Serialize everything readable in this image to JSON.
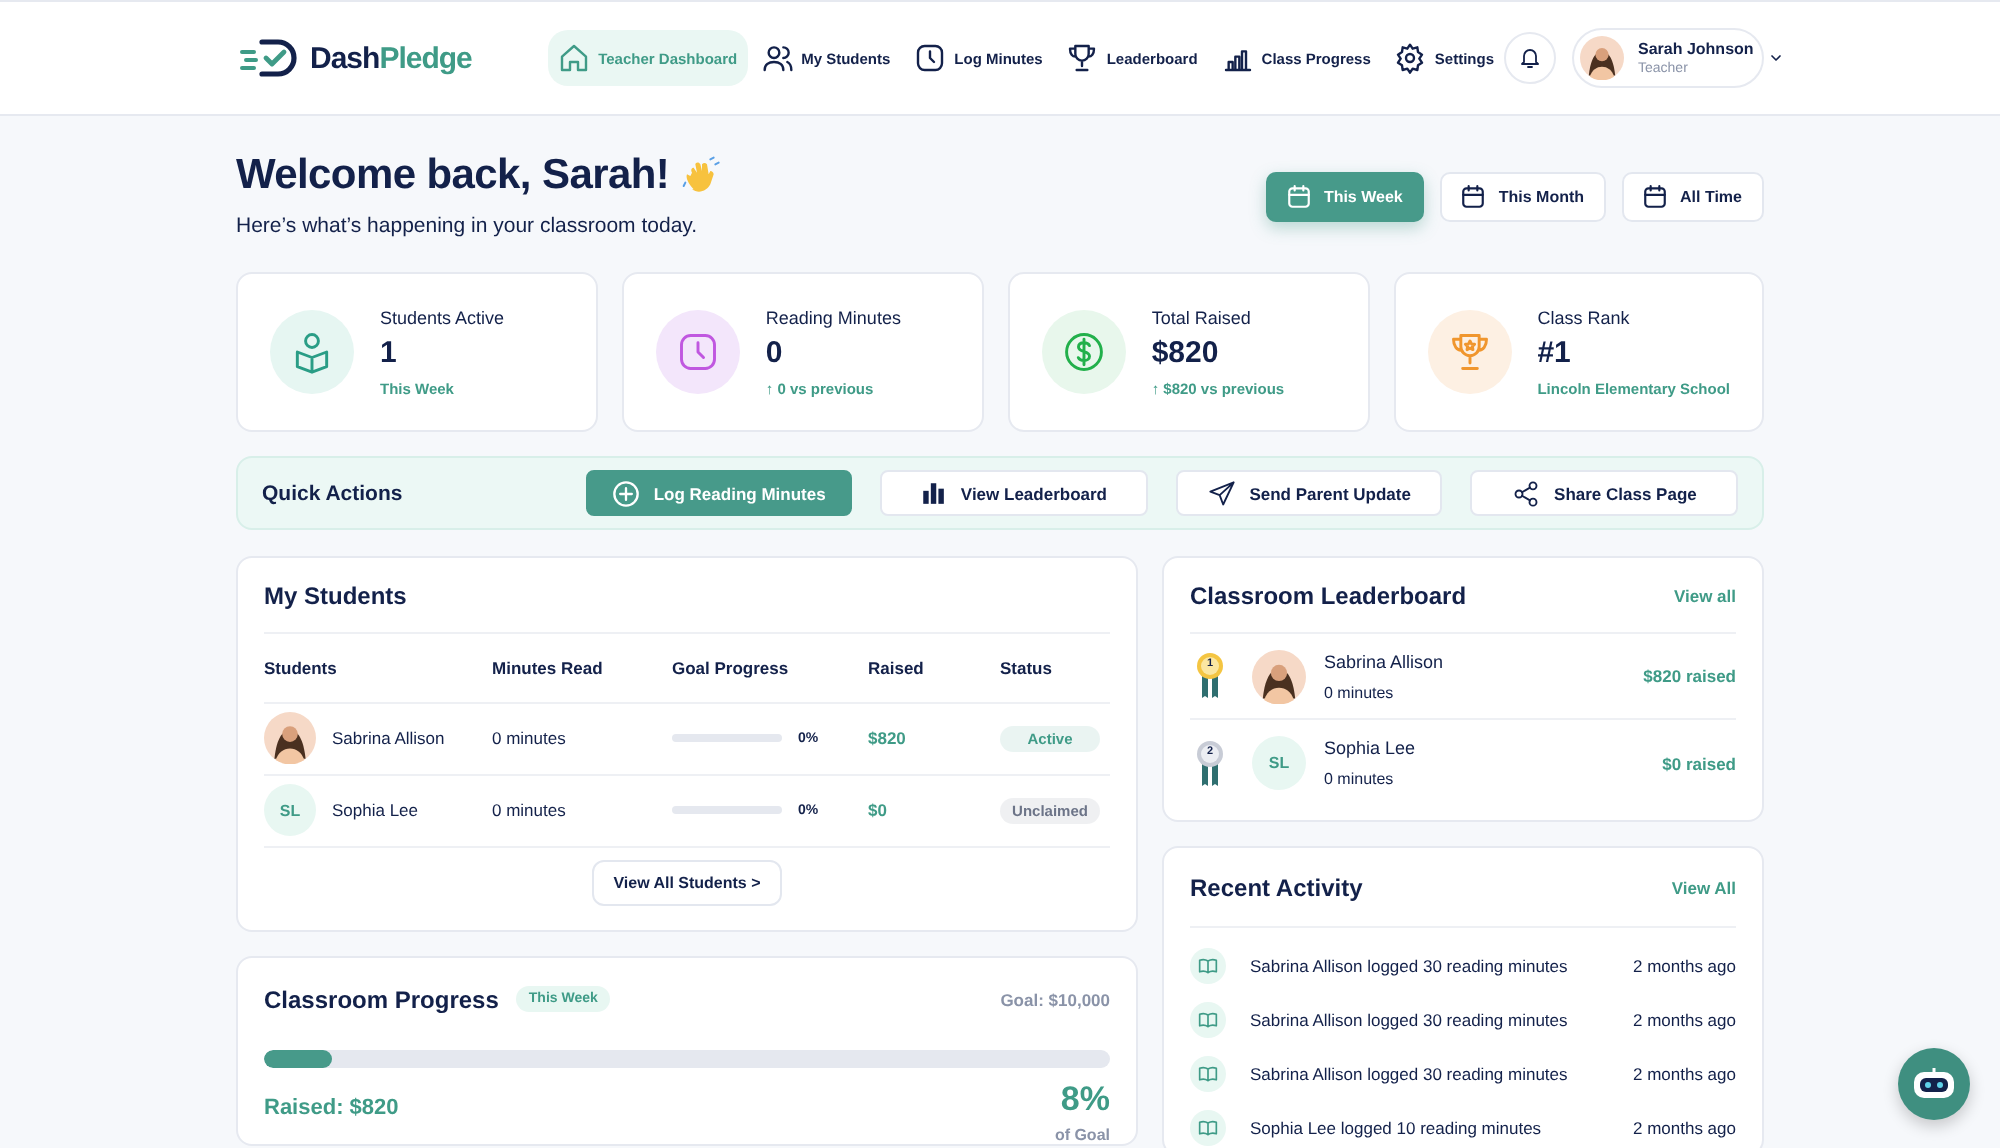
{
  "brand": {
    "parts": [
      "Dash",
      "Pledge"
    ]
  },
  "nav": [
    {
      "label": "Teacher Dashboard",
      "selected": true
    },
    {
      "label": "My Students",
      "selected": false
    },
    {
      "label": "Log Minutes",
      "selected": false
    },
    {
      "label": "Leaderboard",
      "selected": false
    },
    {
      "label": "Class Progress",
      "selected": false
    },
    {
      "label": "Settings",
      "selected": false
    }
  ],
  "user": {
    "name": "Sarah Johnson",
    "role": "Teacher"
  },
  "welcome": {
    "title": "Welcome back, Sarah!",
    "subtitle": "Here’s what’s happening in your classroom today."
  },
  "periods": [
    {
      "label": "This Week",
      "selected": true
    },
    {
      "label": "This Month",
      "selected": false
    },
    {
      "label": "All Time",
      "selected": false
    }
  ],
  "stats": [
    {
      "label": "Students Active",
      "value": "1",
      "note": "This Week"
    },
    {
      "label": "Reading Minutes",
      "value": "0",
      "note": "↑ 0 vs previous"
    },
    {
      "label": "Total Raised",
      "value": "$820",
      "note": "↑ $820 vs previous"
    },
    {
      "label": "Class Rank",
      "value": "#1",
      "note": "Lincoln Elementary School"
    }
  ],
  "quick_actions": {
    "title": "Quick Actions",
    "actions": [
      {
        "label": "Log Reading Minutes",
        "kind": "primary"
      },
      {
        "label": "View Leaderboard",
        "kind": "secondary"
      },
      {
        "label": "Send Parent Update",
        "kind": "secondary"
      },
      {
        "label": "Share Class Page",
        "kind": "secondary"
      }
    ]
  },
  "students": {
    "title": "My Students",
    "columns": [
      "Students",
      "Minutes Read",
      "Goal Progress",
      "Raised",
      "Status"
    ],
    "rows": [
      {
        "name": "Sabrina Allison",
        "minutes": "0 minutes",
        "level": 0,
        "percent": "0%",
        "raised": "$820",
        "status": {
          "label": "Active",
          "color": "#3f9b87"
        }
      },
      {
        "avatar": {
          "kind": "initials",
          "initials": "SL"
        },
        "name": "Sophia Lee",
        "minutes": "0 minutes",
        "level": 0,
        "percent": "0%",
        "raised": "$0",
        "status": {
          "label": "Unclaimed",
          "color": "#6c7488"
        }
      }
    ],
    "view_all": "View All Students >"
  },
  "progress": {
    "title": "Classroom Progress",
    "badge": "This Week",
    "goal": "Goal: $10,000",
    "level": 0.08,
    "raised": "Raised: $820",
    "percent": "8%",
    "caption": "of Goal"
  },
  "leaderboard": {
    "title": "Classroom Leaderboard",
    "link": "View all",
    "entries": [
      {
        "rank": "1",
        "name": "Sabrina Allison",
        "minutes": "0 minutes",
        "raised": "$820 raised"
      },
      {
        "rank": "2",
        "avatar": {
          "kind": "initials",
          "initials": "SL"
        },
        "name": "Sophia Lee",
        "minutes": "0 minutes",
        "raised": "$0 raised"
      }
    ]
  },
  "activity": {
    "title": "Recent Activity",
    "link": "View All",
    "items": [
      {
        "text": "Sabrina Allison logged 30 reading minutes",
        "time": "2 months ago"
      },
      {
        "text": "Sabrina Allison logged 30 reading minutes",
        "time": "2 months ago"
      },
      {
        "text": "Sabrina Allison logged 30 reading minutes",
        "time": "2 months ago"
      },
      {
        "text": "Sophia Lee logged 10 reading minutes",
        "time": "2 months ago"
      }
    ]
  }
}
